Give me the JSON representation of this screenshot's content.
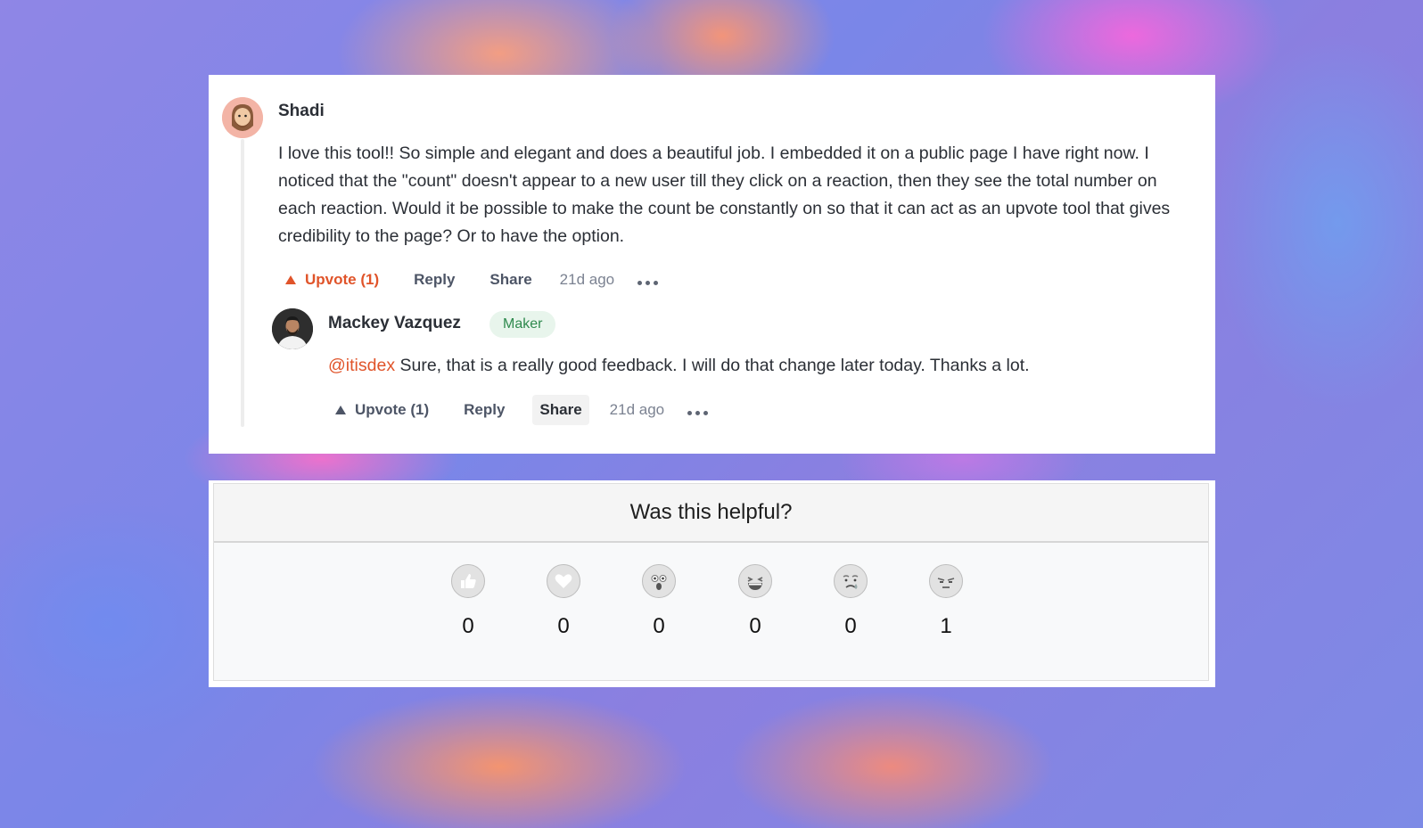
{
  "comment": {
    "author": "Shadi",
    "body": "I love this tool!! So simple and elegant and does a beautiful job. I embedded it on a public page I have right now. I noticed that the \"count\" doesn't appear to a new user till they click on a reaction, then they see the total number on each reaction. Would it be possible to make the count be constantly on so that it can act as an upvote tool that gives credibility to the page? Or to have the option.",
    "upvote_label": "Upvote (1)",
    "reply_label": "Reply",
    "share_label": "Share",
    "timestamp": "21d ago",
    "upvoted": true
  },
  "reply": {
    "author": "Mackey Vazquez",
    "badge": "Maker",
    "mention": "@itisdex",
    "body": " Sure, that is a really good feedback. I will do that change later today. Thanks a lot.",
    "upvote_label": "Upvote (1)",
    "reply_label": "Reply",
    "share_label": "Share",
    "timestamp": "21d ago"
  },
  "widget": {
    "title": "Was this helpful?",
    "reactions": [
      {
        "icon": "thumbs-up-icon",
        "count": "0"
      },
      {
        "icon": "heart-icon",
        "count": "0"
      },
      {
        "icon": "surprised-face-icon",
        "count": "0"
      },
      {
        "icon": "laughing-face-icon",
        "count": "0"
      },
      {
        "icon": "crying-face-icon",
        "count": "0"
      },
      {
        "icon": "annoyed-face-icon",
        "count": "1"
      }
    ]
  },
  "colors": {
    "accent": "#e0542a",
    "badge_bg": "#e8f5ec",
    "badge_text": "#2f8a4e"
  }
}
